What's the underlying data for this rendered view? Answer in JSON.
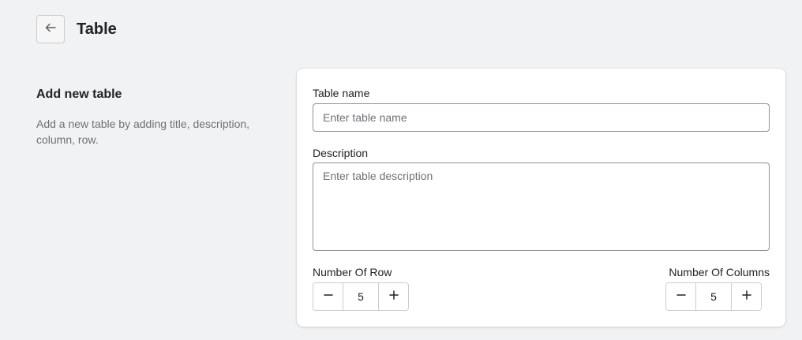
{
  "header": {
    "back_icon": "arrow-left-icon",
    "title": "Table"
  },
  "section": {
    "title": "Add new table",
    "description": "Add a new table by adding title, description, column, row."
  },
  "form": {
    "table_name": {
      "label": "Table name",
      "value": "",
      "placeholder": "Enter table name"
    },
    "description": {
      "label": "Description",
      "value": "",
      "placeholder": "Enter table description"
    },
    "rows": {
      "label": "Number Of Row",
      "value": "5",
      "decrement_icon": "minus-icon",
      "increment_icon": "plus-icon"
    },
    "columns": {
      "label": "Number Of Columns",
      "value": "5",
      "decrement_icon": "minus-icon",
      "increment_icon": "plus-icon"
    }
  },
  "colors": {
    "background": "#f1f2f4",
    "card": "#ffffff",
    "border": "#8c9196",
    "text": "#202223",
    "muted_text": "#6d7175"
  }
}
